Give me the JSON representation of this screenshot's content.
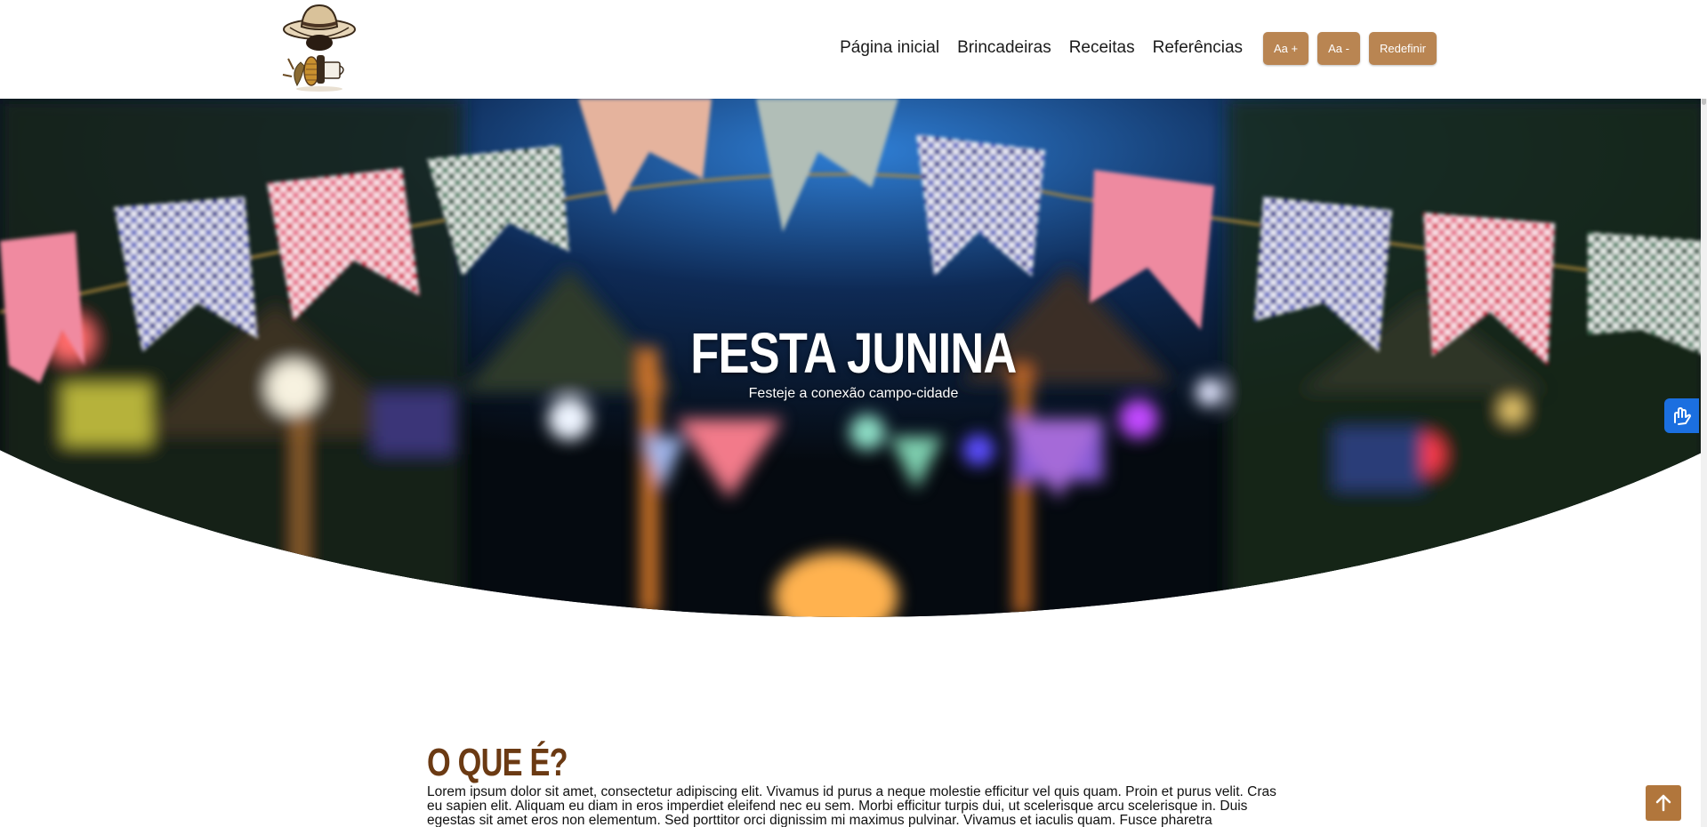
{
  "header": {
    "logo_alt": "Festa Junina logo",
    "nav": [
      {
        "label": "Página inicial"
      },
      {
        "label": "Brincadeiras"
      },
      {
        "label": "Receitas"
      },
      {
        "label": "Referências"
      }
    ],
    "buttons": {
      "increase_font": "Aa +",
      "decrease_font": "Aa -",
      "reset": "Redefinir"
    }
  },
  "hero": {
    "title": "FESTA JUNINA",
    "subtitle": "Festeje a conexão campo-cidade"
  },
  "section": {
    "title": "O QUE É?",
    "body": "Lorem ipsum dolor sit amet, consectetur adipiscing elit. Vivamus id purus a neque molestie efficitur vel quis quam. Proin et purus velit. Cras eu sapien elit. Aliquam eu diam in eros imperdiet eleifend nec eu sem. Morbi efficitur turpis dui, ut scelerisque arcu scelerisque in. Duis egestas sit amet eros non elementum. Sed porttitor orci dignissim mi maximus pulvinar. Vivamus et iaculis quam. Fusce pharetra"
  },
  "widgets": {
    "accessibility": "vlibras-hands-icon",
    "back_to_top": "arrow-up-icon"
  },
  "colors": {
    "accent": "#b98552",
    "heading": "#6b3a13",
    "accessibility_blue": "#1b6fe0",
    "back_to_top": "#b1763c"
  }
}
